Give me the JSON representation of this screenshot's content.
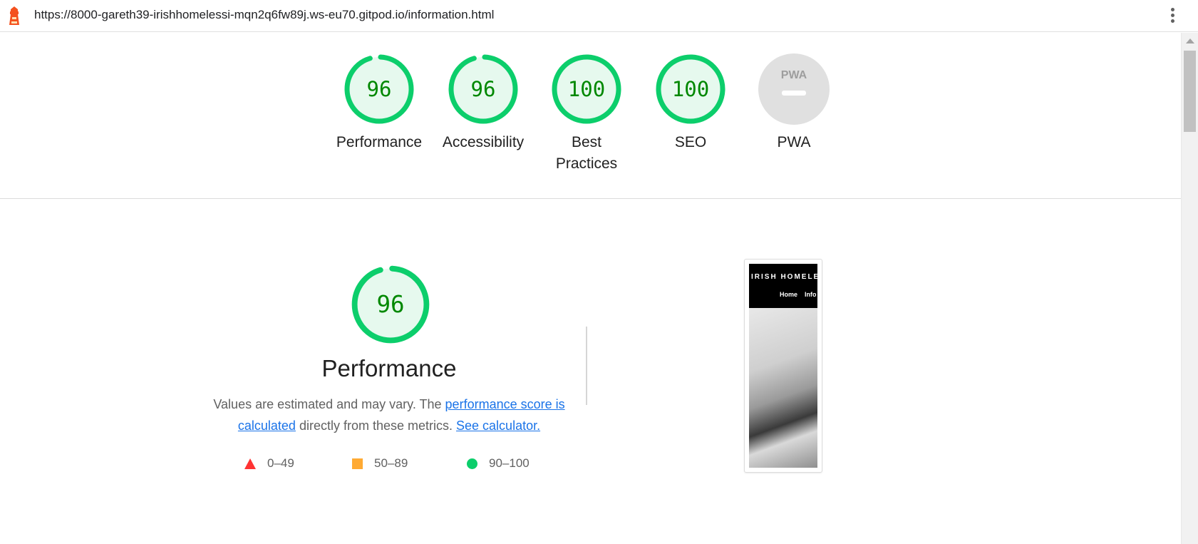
{
  "browser": {
    "url": "https://8000-gareth39-irishhomelessi-mqn2q6fw89j.ws-eu70.gitpod.io/information.html"
  },
  "summary": {
    "gauges": [
      {
        "label_line1": "Performance",
        "label_line2": "",
        "score": "96",
        "level": 0.96
      },
      {
        "label_line1": "Accessibility",
        "label_line2": "",
        "score": "96",
        "level": 0.96
      },
      {
        "label_line1": "Best",
        "label_line2": "Practices",
        "score": "100",
        "level": 1.0
      },
      {
        "label_line1": "SEO",
        "label_line2": "",
        "score": "100",
        "level": 1.0
      },
      {
        "label_line1": "PWA",
        "label_line2": "",
        "score": "PWA",
        "level": 0
      }
    ]
  },
  "performance": {
    "score": "96",
    "level": 0.96,
    "title": "Performance",
    "desc_prefix": "Values are estimated and may vary. The ",
    "desc_link1": "performance score is calculated",
    "desc_middle": " directly from these metrics. ",
    "desc_link2": "See calculator.",
    "legend": [
      {
        "range": "0–49",
        "shape": "triangle-icon",
        "color": "#ff3333"
      },
      {
        "range": "50–89",
        "shape": "square-icon",
        "color": "#ffaa33"
      },
      {
        "range": "90–100",
        "shape": "circle-icon",
        "color": "#0cce6b"
      }
    ]
  },
  "thumbnail": {
    "brand": "IRISH HOMELESS",
    "nav_home": "Home",
    "nav_info": "Info"
  },
  "colors": {
    "pass_green": "#0cce6b",
    "pass_text": "#008800",
    "pass_fill": "#e6f9ee",
    "na_gray": "#e0e0e0"
  }
}
